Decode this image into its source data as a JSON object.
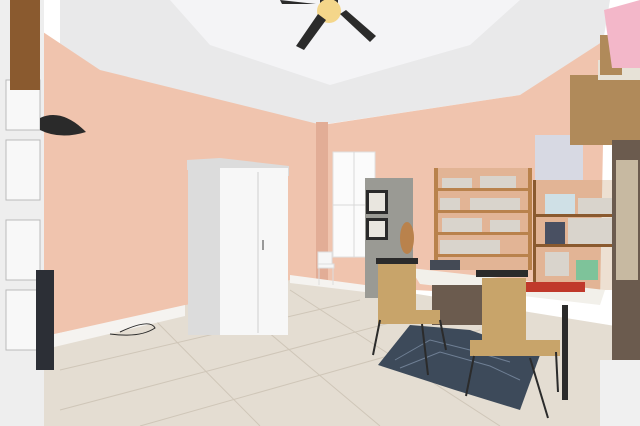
{
  "scene": {
    "kind": "room-photo",
    "objects": [
      "ceiling-fan",
      "white-wardrobe",
      "shuttered-window",
      "wooden-shelving",
      "storage-drawers",
      "desk",
      "woven-chairs",
      "area-rug",
      "small-white-chair",
      "framed-pictures",
      "boxes"
    ],
    "colors": {
      "wall": "#f0c4ae",
      "wall_shadow": "#e2ad96",
      "ceiling": "#e9e9ea",
      "ceiling_recess": "#f4f4f6",
      "floor": "#e4ddd2",
      "floor_grout": "#cfc6b8",
      "baseboard": "#f5f3f0",
      "wardrobe": "#f7f7f7",
      "wardrobe_shade": "#dcdcdc",
      "wood": "#b9824c",
      "wood_dark": "#8a5a2f",
      "rug": "#3d4a5a",
      "chair_wicker": "#c8a46a",
      "chair_frame": "#2b2b2b",
      "desk_top": "#f2f0ea",
      "window_light": "#fbfbfb",
      "shelf_items": "#d9d4cc",
      "box": "#b08a5a",
      "pink_bin": "#f3b7c9"
    }
  }
}
